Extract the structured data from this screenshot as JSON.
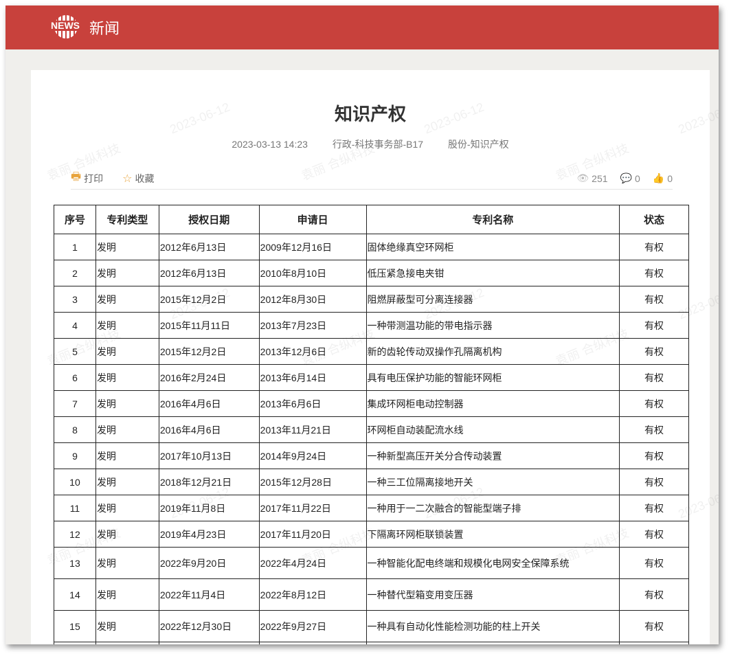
{
  "header": {
    "logo_text": "NEWS",
    "title": "新闻"
  },
  "article": {
    "title": "知识产权",
    "date": "2023-03-13 14:23",
    "department": "行政-科技事务部-B17",
    "category": "股份-知识产权"
  },
  "toolbar": {
    "print": "打印",
    "favorite": "收藏",
    "views": "251",
    "comments": "0",
    "likes": "0"
  },
  "watermark": {
    "date": "2023-06-12",
    "text": "袁丽 合纵科技"
  },
  "table": {
    "headers": [
      "序号",
      "专利类型",
      "授权日期",
      "申请日",
      "专利名称",
      "状态"
    ],
    "rows": [
      [
        "1",
        "发明",
        "2012年6月13日",
        "2009年12月16日",
        "固体绝缘真空环网柜",
        "有权"
      ],
      [
        "2",
        "发明",
        "2012年6月13日",
        "2010年8月10日",
        "低压紧急接电夹钳",
        "有权"
      ],
      [
        "3",
        "发明",
        "2015年12月2日",
        "2012年8月30日",
        "阻燃屏蔽型可分离连接器",
        "有权"
      ],
      [
        "4",
        "发明",
        "2015年11月11日",
        "2013年7月23日",
        "一种带测温功能的带电指示器",
        "有权"
      ],
      [
        "5",
        "发明",
        "2015年12月2日",
        "2013年12月6日",
        "新的齿轮传动双操作孔隔离机构",
        "有权"
      ],
      [
        "6",
        "发明",
        "2016年2月24日",
        "2013年6月14日",
        "具有电压保护功能的智能环网柜",
        "有权"
      ],
      [
        "7",
        "发明",
        "2016年4月6日",
        "2013年6月6日",
        "集成环网柜电动控制器",
        "有权"
      ],
      [
        "8",
        "发明",
        "2016年4月6日",
        "2013年11月21日",
        "环网柜自动装配流水线",
        "有权"
      ],
      [
        "9",
        "发明",
        "2017年10月13日",
        "2014年9月24日",
        "一种新型高压开关分合传动装置",
        "有权"
      ],
      [
        "10",
        "发明",
        "2018年12月21日",
        "2015年12月28日",
        "一种三工位隔离接地开关",
        "有权"
      ],
      [
        "11",
        "发明",
        "2019年11月8日",
        "2017年11月22日",
        "一种用于一二次融合的智能型端子排",
        "有权"
      ],
      [
        "12",
        "发明",
        "2019年4月23日",
        "2017年11月20日",
        "下隔离环网柜联锁装置",
        "有权"
      ],
      [
        "13",
        "发明",
        "2022年9月20日",
        "2022年4月24日",
        "一种智能化配电终端和规模化电网安全保障系统",
        "有权"
      ],
      [
        "14",
        "发明",
        "2022年11月4日",
        "2022年8月12日",
        "一种替代型箱变用变压器",
        "有权"
      ],
      [
        "15",
        "发明",
        "2022年12月30日",
        "2022年9月27日",
        "一种具有自动化性能检测功能的柱上开关",
        "有权"
      ]
    ]
  }
}
